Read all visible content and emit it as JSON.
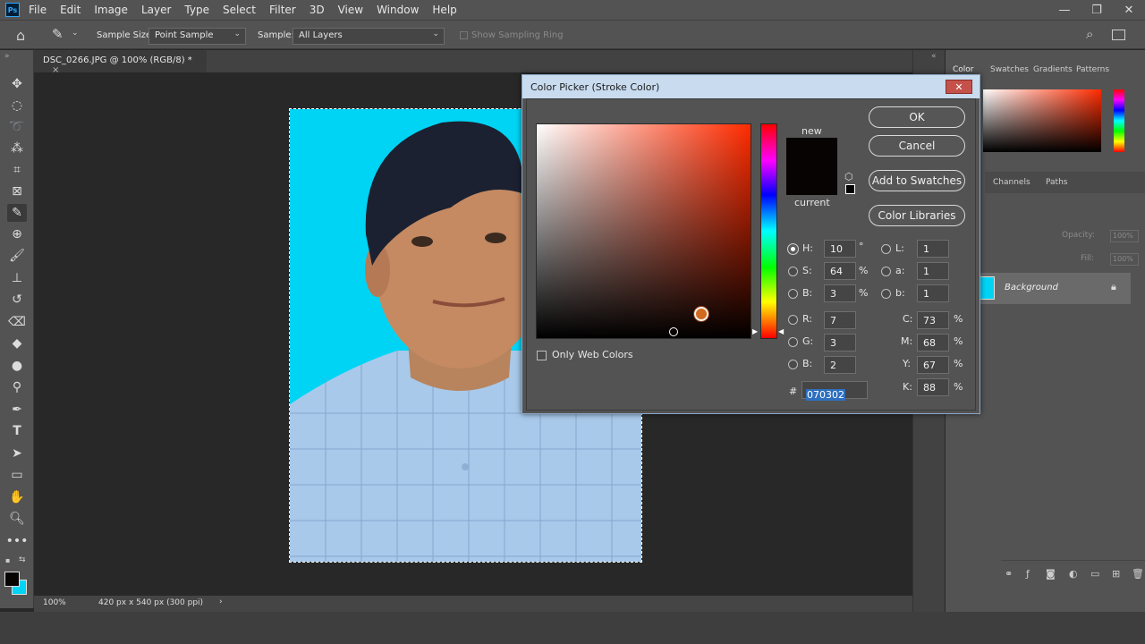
{
  "menubar": {
    "logo": "Ps",
    "items": [
      "File",
      "Edit",
      "Image",
      "Layer",
      "Type",
      "Select",
      "Filter",
      "3D",
      "View",
      "Window",
      "Help"
    ]
  },
  "optionsbar": {
    "sample_size_label": "Sample Size:",
    "sample_size_value": "Point Sample",
    "sample_label": "Sample:",
    "sample_value": "All Layers",
    "show_ring_label": "Show Sampling Ring"
  },
  "document": {
    "tab_title": "DSC_0266.JPG @ 100% (RGB/8) *",
    "tab_close": "×"
  },
  "statusbar": {
    "zoom": "100%",
    "doc_info": "420 px x 540 px (300 ppi)"
  },
  "panels": {
    "tabs": [
      "Color",
      "Swatches",
      "Gradients",
      "Patterns"
    ],
    "layer_tabs": [
      "Channels",
      "Paths"
    ],
    "opacity_label": "Opacity:",
    "opacity_value": "100%",
    "fill_label": "Fill:",
    "fill_value": "100%",
    "layer_name": "Background"
  },
  "dialog": {
    "title": "Color Picker (Stroke Color)",
    "new_label": "new",
    "current_label": "current",
    "buttons": {
      "ok": "OK",
      "cancel": "Cancel",
      "add_swatches": "Add to Swatches",
      "color_libraries": "Color Libraries"
    },
    "fields": {
      "H": {
        "label": "H:",
        "value": "10",
        "unit": "°"
      },
      "S": {
        "label": "S:",
        "value": "64",
        "unit": "%"
      },
      "Bri": {
        "label": "B:",
        "value": "3",
        "unit": "%"
      },
      "R": {
        "label": "R:",
        "value": "7"
      },
      "G": {
        "label": "G:",
        "value": "3"
      },
      "B": {
        "label": "B:",
        "value": "2"
      },
      "L": {
        "label": "L:",
        "value": "1"
      },
      "a": {
        "label": "a:",
        "value": "1"
      },
      "b": {
        "label": "b:",
        "value": "1"
      },
      "C": {
        "label": "C:",
        "value": "73",
        "unit": "%"
      },
      "M": {
        "label": "M:",
        "value": "68",
        "unit": "%"
      },
      "Y": {
        "label": "Y:",
        "value": "67",
        "unit": "%"
      },
      "K": {
        "label": "K:",
        "value": "88",
        "unit": "%"
      }
    },
    "only_web_colors": "Only Web Colors",
    "hex_label": "#",
    "hex_value": "070302",
    "selected_color": "#070302"
  }
}
